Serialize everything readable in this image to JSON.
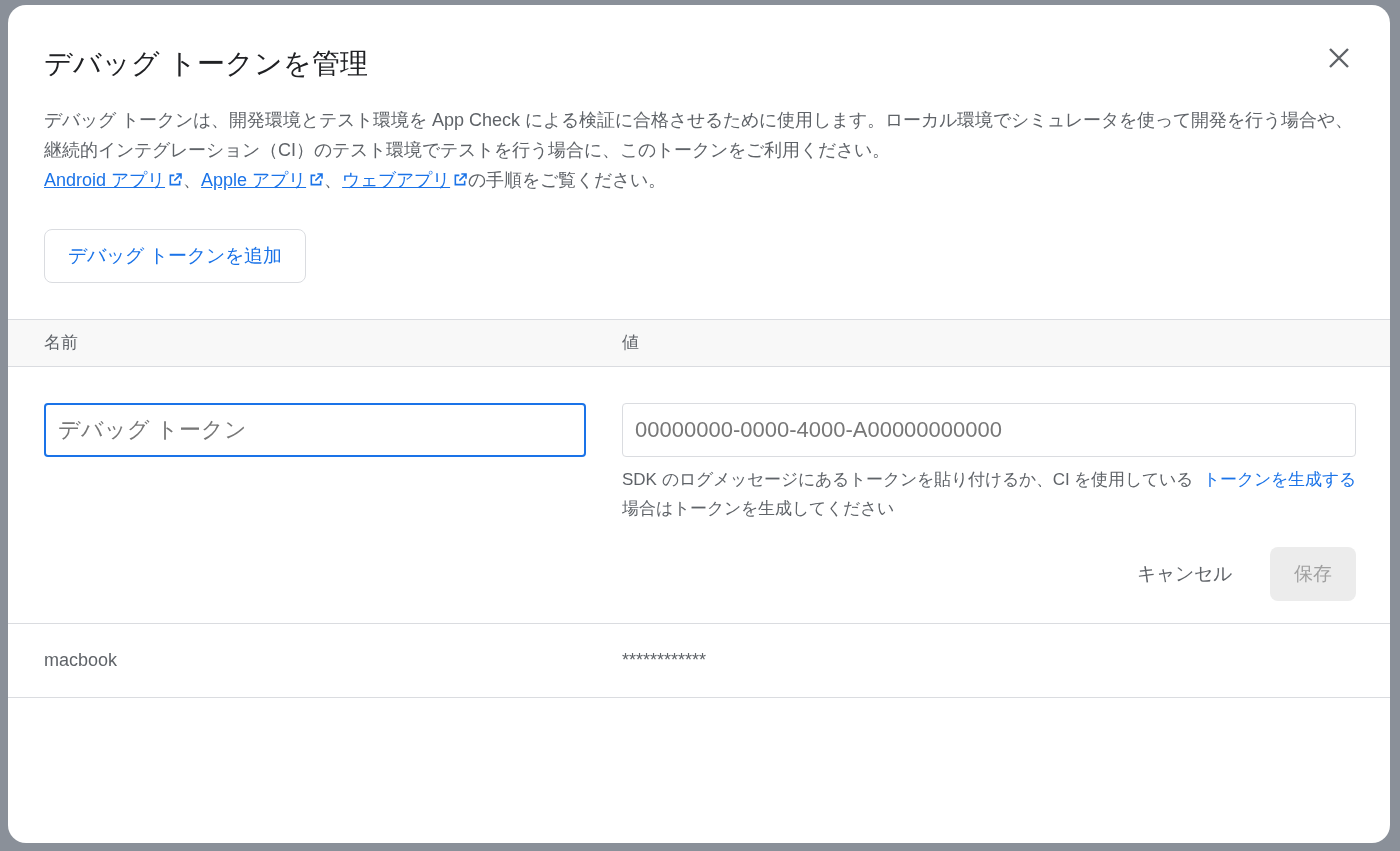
{
  "dialog": {
    "title": "デバッグ トークンを管理",
    "description": "デバッグ トークンは、開発環境とテスト環境を App Check による検証に合格させるために使用します。ローカル環境でシミュレータを使って開発を行う場合や、継続的インテグレーション（CI）のテスト環境でテストを行う場合に、このトークンをご利用ください。",
    "links": [
      {
        "label": "Android アプリ"
      },
      {
        "label": "Apple アプリ"
      },
      {
        "label": "ウェブアプリ"
      }
    ],
    "link_separator": "、",
    "links_suffix": "の手順をご覧ください。",
    "add_button": "デバッグ トークンを追加",
    "table": {
      "columns": [
        "名前",
        "値"
      ],
      "new_row": {
        "name_field": {
          "placeholder": "デバッグ トークン",
          "focused": true
        },
        "value_field": {
          "placeholder": "00000000-0000-4000-A00000000000",
          "focused": false
        },
        "hint": "SDK のログメッセージにあるトークンを貼り付けるか、CI を使用している場合はトークンを生成してください",
        "generate_link": "トークンを生成する",
        "cancel": "キャンセル",
        "save": {
          "label": "保存",
          "disabled": true
        }
      },
      "rows": [
        {
          "name": "macbook",
          "value": "************"
        }
      ]
    }
  }
}
